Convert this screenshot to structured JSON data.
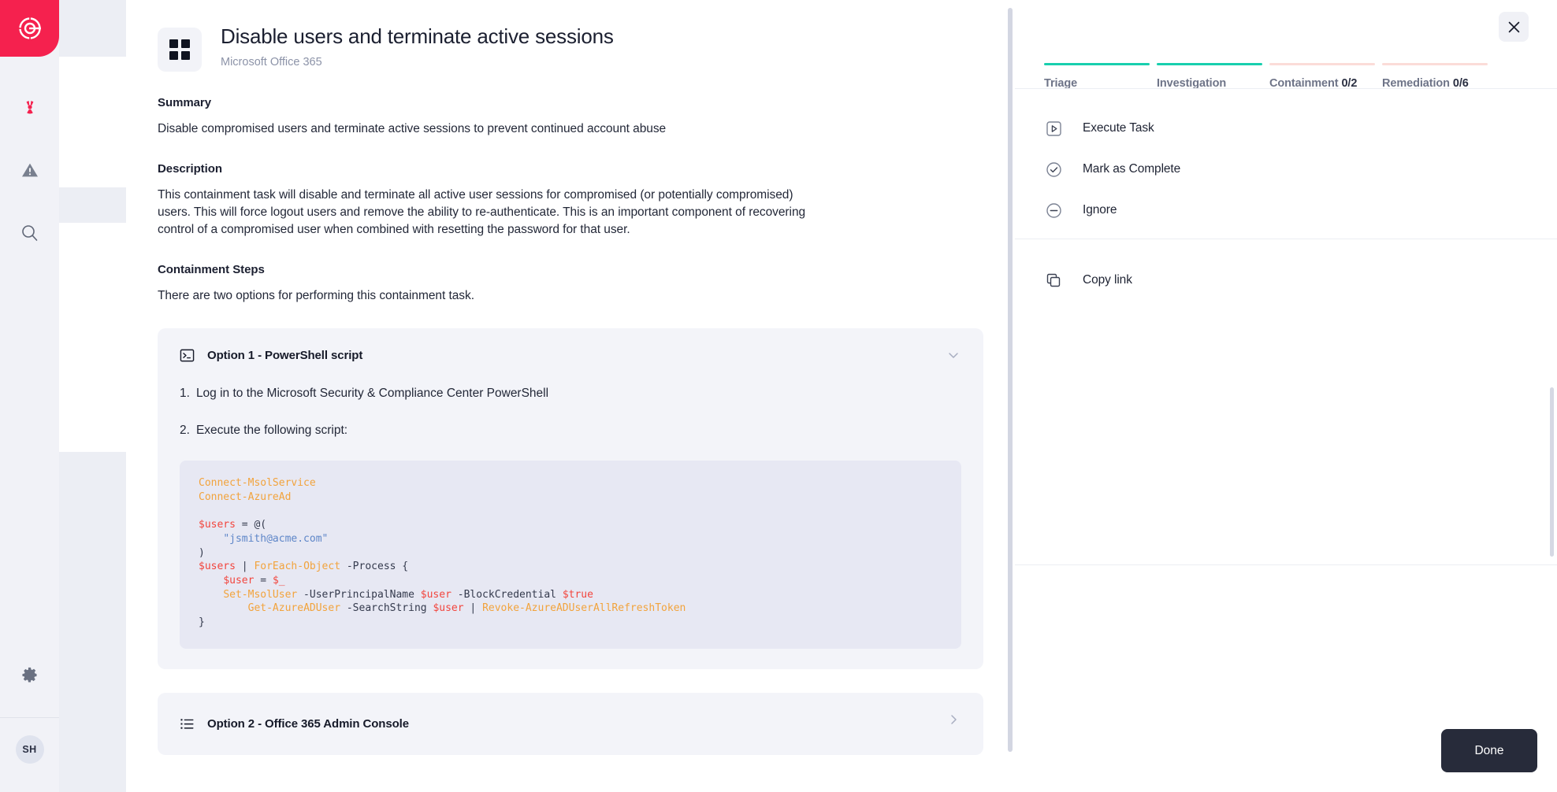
{
  "rail": {
    "logo": "logo-icon",
    "items": [
      {
        "name": "radiation-icon",
        "label": "Incidents"
      },
      {
        "name": "alert-triangle-icon",
        "label": "Alerts"
      },
      {
        "name": "search-icon",
        "label": "Search"
      }
    ],
    "settings_label": "Settings",
    "avatar_initials": "SH"
  },
  "doc": {
    "title": "Disable users and terminate active sessions",
    "subtitle": "Microsoft Office 365",
    "app_icon": "grid-icon",
    "summary_heading": "Summary",
    "summary_text": "Disable compromised users and terminate active sessions to prevent continued account abuse",
    "description_heading": "Description",
    "description_text": "This containment task will disable and terminate all active user sessions for compromised (or potentially compromised) users. This will force logout users and remove the ability to re-authenticate. This is an important component of recovering control of a compromised user when combined with resetting the password for that user.",
    "steps_heading": "Containment Steps",
    "steps_text": "There are two options for performing this containment task.",
    "option1": {
      "icon": "terminal-icon",
      "title": "Option 1 - PowerShell script",
      "chevron": "chevron-down-icon",
      "expanded": true,
      "step1_num": "1.",
      "step1_text": "Log in to the Microsoft Security & Compliance Center PowerShell",
      "step2_num": "2.",
      "step2_text": "Execute the following script:",
      "code_lines": [
        {
          "t": "cmd",
          "v": "Connect-MsolService"
        },
        {
          "t": "cmd",
          "v": "Connect-AzureAd"
        },
        {
          "t": "blank",
          "v": ""
        },
        {
          "t": "raw",
          "v": "$users = @("
        },
        {
          "t": "raw",
          "v": "    \"jsmith@acme.com\""
        },
        {
          "t": "raw",
          "v": ")"
        },
        {
          "t": "raw",
          "v": "$users | ForEach-Object -Process {"
        },
        {
          "t": "raw",
          "v": "    $user = $_"
        },
        {
          "t": "raw",
          "v": "    Set-MsolUser -UserPrincipalName $user -BlockCredential $true"
        },
        {
          "t": "raw",
          "v": "        Get-AzureADUser -SearchString $user | Revoke-AzureADUserAllRefreshToken"
        },
        {
          "t": "raw",
          "v": "}"
        }
      ]
    },
    "option2": {
      "icon": "list-icon",
      "title": "Option 2 - Office 365 Admin Console",
      "chevron": "chevron-right-icon",
      "expanded": false
    }
  },
  "side": {
    "close_icon": "close-icon",
    "tabs": [
      {
        "label": "Triage",
        "count": "",
        "state": "done"
      },
      {
        "label": "Investigation",
        "count": "",
        "state": "done"
      },
      {
        "label": "Containment",
        "count": "0/2",
        "state": "todo"
      },
      {
        "label": "Remediation",
        "count": "0/6",
        "state": "todo"
      }
    ],
    "actions": [
      {
        "icon": "play-square-icon",
        "label": "Execute Task"
      },
      {
        "icon": "check-circle-icon",
        "label": "Mark as Complete"
      },
      {
        "icon": "minus-circle-icon",
        "label": "Ignore"
      }
    ],
    "copy": {
      "icon": "copy-icon",
      "label": "Copy link"
    },
    "done_label": "Done"
  },
  "colors": {
    "brand": "#f5214e",
    "tab_done": "#18cfae",
    "tab_todo": "#fbdcd8",
    "done_button": "#272b3a",
    "code_cmd": "#f2a33c",
    "code_var": "#f2453d",
    "code_str": "#5e86c8"
  }
}
